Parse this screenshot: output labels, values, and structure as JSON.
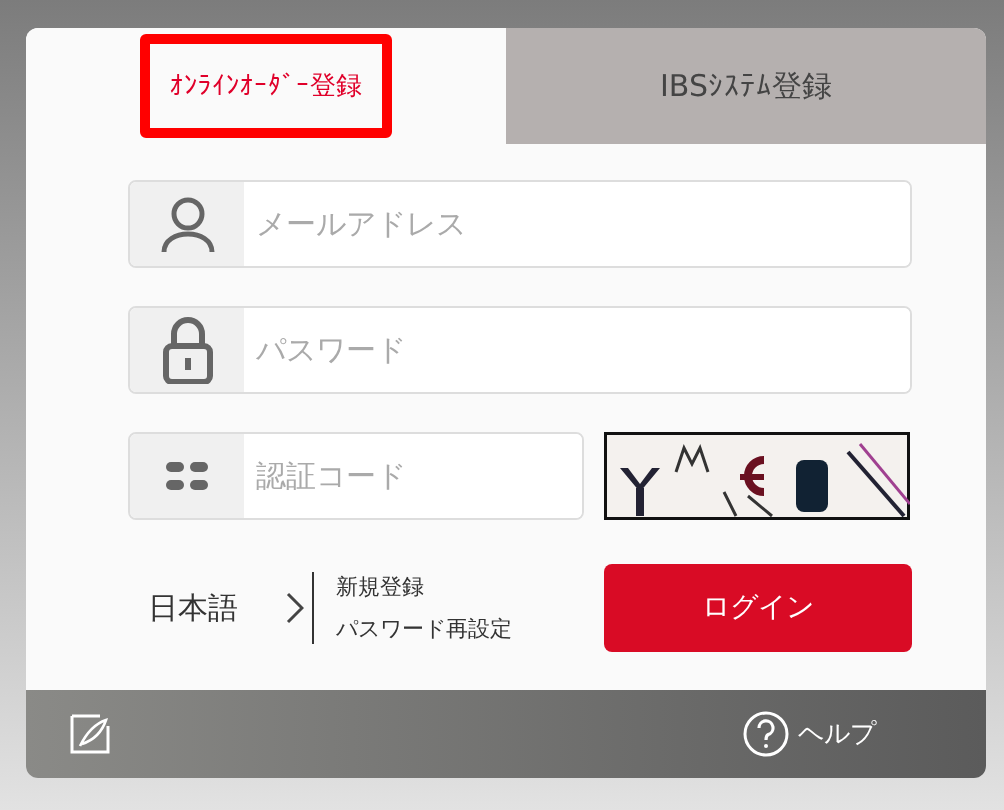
{
  "tabs": [
    {
      "label": "ｵﾝﾗｲﾝｵｰﾀﾞｰ登録",
      "selected": true
    },
    {
      "label": "IBSｼｽﾃﾑ登録",
      "selected": false
    }
  ],
  "fields": [
    {
      "kind": "user",
      "placeholder": "メールアドレス"
    },
    {
      "kind": "lock",
      "placeholder": "パスワード"
    }
  ],
  "captcha": {
    "placeholder": "認証コード",
    "kind": "picture"
  },
  "language": "日本語",
  "links": [
    "新規登録",
    "パスワード再設定"
  ],
  "login_button": "ログイン",
  "footer": {
    "help": "ヘルプ"
  }
}
